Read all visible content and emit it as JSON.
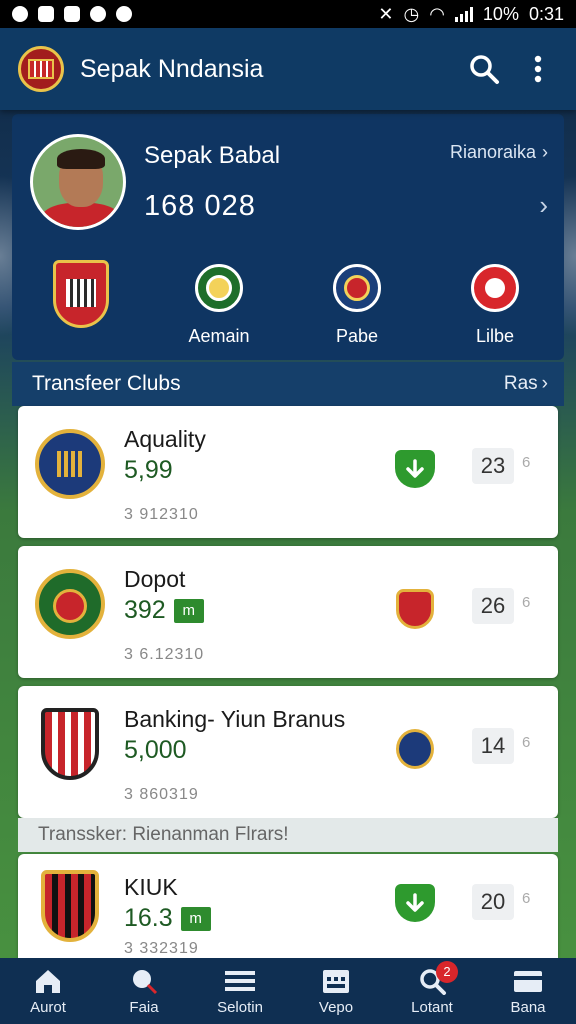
{
  "status_bar": {
    "battery": "10%",
    "time": "0:31"
  },
  "app_bar": {
    "title": "Sepak Nndansia"
  },
  "profile": {
    "name": "Sepak Babal",
    "score": "168 028",
    "link_label": "Rianoraika",
    "badges": [
      {
        "label": ""
      },
      {
        "label": "Aemain"
      },
      {
        "label": "Pabe"
      },
      {
        "label": "Lilbe"
      }
    ]
  },
  "transfer_section": {
    "title": "Transfeer Clubs",
    "link_label": "Ras"
  },
  "clubs": [
    {
      "name": "Aquality",
      "value": "5,99",
      "trend": "",
      "date": "3 912310",
      "rank": "23",
      "small": "6",
      "status": "check"
    },
    {
      "name": "Dopot",
      "value": "392",
      "trend": "m",
      "date": "3 6.12310",
      "rank": "26",
      "small": "6",
      "status": "crest"
    },
    {
      "name": "Banking- Yiun Branus",
      "value": "5,000",
      "trend": "",
      "date": "3 860319",
      "rank": "14",
      "small": "6",
      "status": "crest"
    },
    {
      "name": "KIUK",
      "value": "16.3",
      "trend": "m",
      "date": "3 332319",
      "rank": "20",
      "small": "6",
      "status": "check"
    }
  ],
  "second_section": {
    "title": "Transsker: Rienanman Flrars!"
  },
  "bottom_nav": {
    "items": [
      {
        "label": "Aurot"
      },
      {
        "label": "Faia"
      },
      {
        "label": "Selotin"
      },
      {
        "label": "Vepo"
      },
      {
        "label": "Lotant",
        "badge": "2"
      },
      {
        "label": "Bana"
      }
    ]
  },
  "colors": {
    "app_bar": "#0f3a64",
    "card_bg": "#0f3562",
    "value_green": "#1e5a23",
    "trend_green": "#2e8b2e",
    "badge_red": "#d8262b"
  }
}
